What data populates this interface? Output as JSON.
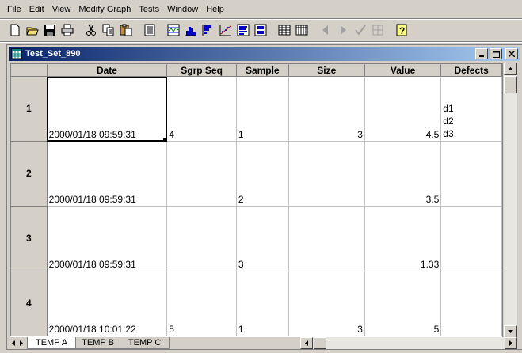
{
  "menubar": {
    "items": [
      "File",
      "Edit",
      "View",
      "Modify Graph",
      "Tests",
      "Window",
      "Help"
    ]
  },
  "toolbar": {
    "icons": [
      "new-icon",
      "open-icon",
      "save-icon",
      "print-icon",
      "cut-icon",
      "copy-icon",
      "paste-icon",
      "report-icon",
      "xbar-chart-icon",
      "histogram-icon",
      "pareto-icon",
      "scatter-icon",
      "run-chart-icon",
      "box-chart-icon",
      "table-icon",
      "datasheet-icon",
      "prev-icon",
      "next-icon",
      "check-icon",
      "grid-icon",
      "help-icon"
    ]
  },
  "window": {
    "title": "Test_Set_890"
  },
  "grid": {
    "columns": [
      "Date",
      "Sgrp Seq",
      "Sample",
      "Size",
      "Value",
      "Defects"
    ],
    "rows": [
      {
        "num": "1",
        "date": "2000/01/18 09:59:31",
        "sgrp": "4",
        "sample": "1",
        "size": "3",
        "value": "4.5",
        "defects": [
          "d1",
          "d2",
          "d3"
        ]
      },
      {
        "num": "2",
        "date": "2000/01/18 09:59:31",
        "sgrp": "",
        "sample": "2",
        "size": "",
        "value": "3.5",
        "defects": []
      },
      {
        "num": "3",
        "date": "2000/01/18 09:59:31",
        "sgrp": "",
        "sample": "3",
        "size": "",
        "value": "1.33",
        "defects": []
      },
      {
        "num": "4",
        "date": "2000/01/18 10:01:22",
        "sgrp": "5",
        "sample": "1",
        "size": "3",
        "value": "5",
        "defects": []
      }
    ]
  },
  "tabs": [
    "TEMP A",
    "TEMP B",
    "TEMP C"
  ],
  "active_tab": "TEMP A"
}
